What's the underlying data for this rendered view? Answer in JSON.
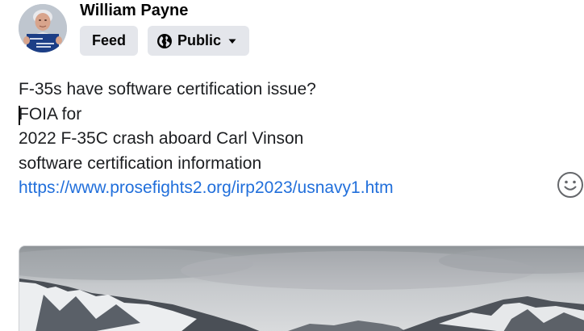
{
  "author": {
    "name": "William Payne",
    "avatar_icon": "user-profile-photo-icon"
  },
  "chips": {
    "feed_label": "Feed",
    "audience_label": "Public",
    "audience_icon": "globe-icon",
    "dropdown_icon": "caret-down-icon"
  },
  "post": {
    "lines": [
      "F-35s have software certification issue?",
      "FOIA for",
      "2022 F-35C crash aboard Carl Vinson",
      "software certification information"
    ],
    "link": "https://www.prosefights2.org/irp2023/usnavy1.htm"
  },
  "emoji_icon": "smiley-face-icon",
  "media": {
    "type": "photo",
    "subject": "snow-capped mountains under overcast sky"
  },
  "colors": {
    "chip_bg": "#e4e6eb",
    "link": "#216fdb",
    "text": "#050505"
  }
}
